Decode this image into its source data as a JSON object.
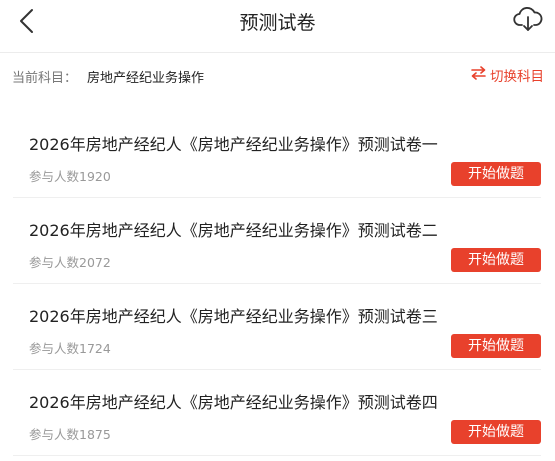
{
  "header": {
    "title": "预测试卷",
    "back_icon": "chevron-left-icon",
    "download_icon": "cloud-download-icon"
  },
  "subject": {
    "label": "当前科目：",
    "value": "房地产经纪业务操作",
    "switch_label": "切换科目",
    "switch_icon": "swap-arrows-icon"
  },
  "colors": {
    "accent": "#e8412c",
    "text": "#222222",
    "muted": "#999999"
  },
  "papers": [
    {
      "title": "2026年房地产经纪人《房地产经纪业务操作》预测试卷一",
      "count": "参与人数1920",
      "button": "开始做题"
    },
    {
      "title": "2026年房地产经纪人《房地产经纪业务操作》预测试卷二",
      "count": "参与人数2072",
      "button": "开始做题"
    },
    {
      "title": "2026年房地产经纪人《房地产经纪业务操作》预测试卷三",
      "count": "参与人数1724",
      "button": "开始做题"
    },
    {
      "title": "2026年房地产经纪人《房地产经纪业务操作》预测试卷四",
      "count": "参与人数1875",
      "button": "开始做题"
    }
  ]
}
